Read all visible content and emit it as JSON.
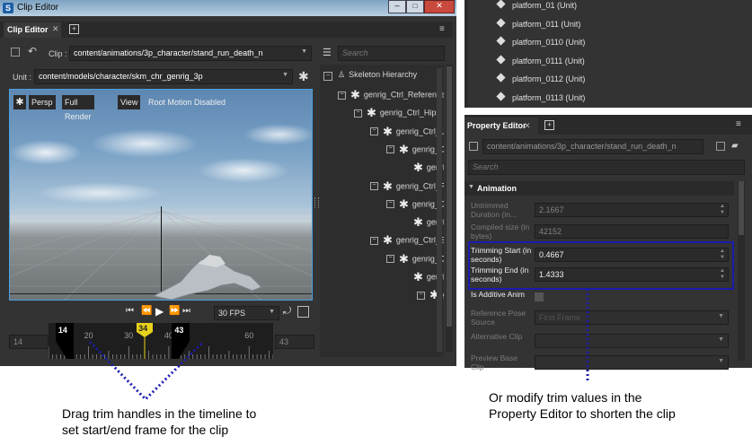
{
  "window": {
    "title": "Clip Editor"
  },
  "clip_tab": {
    "label": "Clip Editor"
  },
  "clip_editor": {
    "clip_label": "Clip :",
    "clip_path": "content/animations/3p_character/stand_run_death_n",
    "unit_label": "Unit :",
    "unit_path": "content/models/character/skm_chr_genrig_3p",
    "search_placeholder": "Search"
  },
  "viewport": {
    "persp": "Persp",
    "full_render": "Full Render",
    "view": "View",
    "root_motion": "Root Motion Disabled"
  },
  "playback": {
    "fps": "30 FPS"
  },
  "timeline": {
    "start_field": "14",
    "end_field": "43",
    "trim_start": "14",
    "trim_end": "43",
    "current": "34",
    "ticks": [
      "20",
      "30",
      "40",
      "60"
    ],
    "range_min": 10,
    "range_max": 66
  },
  "skeleton": {
    "root": "Skeleton Hierarchy",
    "nodes": [
      "genrig_Ctrl_Reference",
      "genrig_Ctrl_Hips",
      "genrig_Ctrl_Le",
      "genrig_Ct",
      "genri",
      "genrig_Ctrl_R",
      "genrig_Ct",
      "genri",
      "genrig_Ctrl_Sp",
      "genrig_Ct",
      "genri",
      "g"
    ]
  },
  "units_list": [
    "platform_01 (Unit)",
    "platform_011 (Unit)",
    "platform_0110 (Unit)",
    "platform_0111 (Unit)",
    "platform_0112 (Unit)",
    "platform_0113 (Unit)"
  ],
  "property_editor": {
    "tab_label": "Property Editor",
    "path": "content/animations/3p_character/stand_run_death_n",
    "search_placeholder": "Search",
    "section": "Animation",
    "rows": [
      {
        "label": "Untrimmed Duration (in...",
        "value": "2.1667"
      },
      {
        "label": "Compiled size (in bytes)",
        "value": "42152"
      },
      {
        "label": "Trimming Start (in seconds)",
        "value": "0.4667"
      },
      {
        "label": "Trimming End (in seconds)",
        "value": "1.4333"
      },
      {
        "label": "Is Additive Anim",
        "value": ""
      },
      {
        "label": "Reference Pose Source",
        "value": "First Frame"
      },
      {
        "label": "Alternative Clip",
        "value": ""
      },
      {
        "label": "Preview Base Clip",
        "value": ""
      }
    ]
  },
  "annotations": {
    "left_line1": "Drag trim handles in the timeline to",
    "left_line2": "set start/end frame for the clip",
    "right_line1": "Or modify trim values in the",
    "right_line2": "Property Editor to shorten the clip"
  },
  "colors": {
    "highlight": "#1b1bb0",
    "playhead": "#e8d21a",
    "handle": "#000000"
  }
}
